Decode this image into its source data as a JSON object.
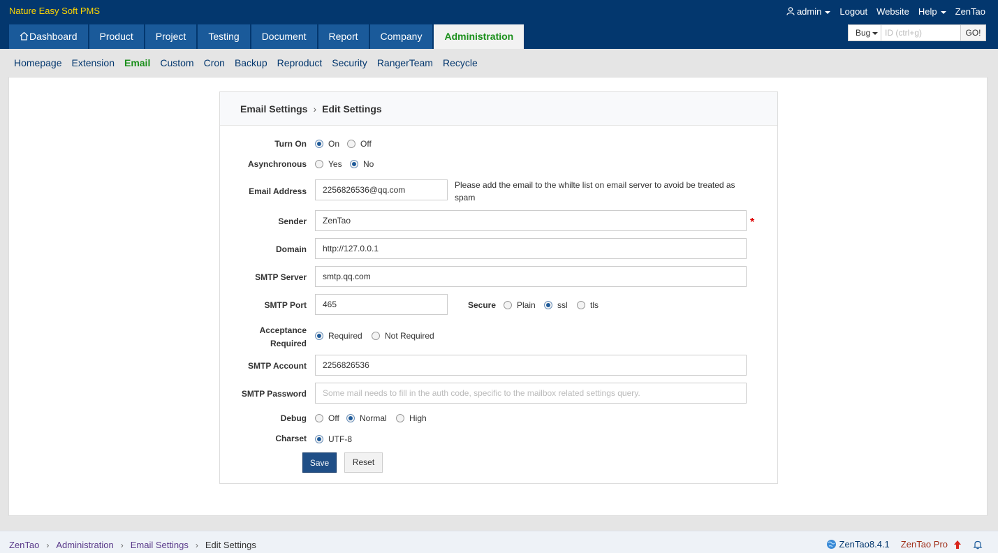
{
  "brand": "Nature Easy Soft PMS",
  "top_links": {
    "user": "admin",
    "logout": "Logout",
    "website": "Website",
    "help": "Help",
    "zentao": "ZenTao"
  },
  "main_nav": [
    "Dashboard",
    "Product",
    "Project",
    "Testing",
    "Document",
    "Report",
    "Company",
    "Administration"
  ],
  "search": {
    "type": "Bug",
    "placeholder": "ID (ctrl+g)",
    "go": "GO!"
  },
  "sub_nav": [
    "Homepage",
    "Extension",
    "Email",
    "Custom",
    "Cron",
    "Backup",
    "Reproduct",
    "Security",
    "RangerTeam",
    "Recycle"
  ],
  "form": {
    "title": "Email Settings",
    "subtitle": "Edit Settings",
    "turn_on": {
      "label": "Turn On",
      "options": [
        "On",
        "Off"
      ],
      "selected": "On"
    },
    "asynchronous": {
      "label": "Asynchronous",
      "options": [
        "Yes",
        "No"
      ],
      "selected": "No"
    },
    "email_address": {
      "label": "Email Address",
      "value": "2256826536@qq.com",
      "note": "Please add the email to the whilte list on email server to avoid be treated as spam"
    },
    "sender": {
      "label": "Sender",
      "value": "ZenTao",
      "required": "*"
    },
    "domain": {
      "label": "Domain",
      "value": "http://127.0.0.1"
    },
    "smtp_server": {
      "label": "SMTP Server",
      "value": "smtp.qq.com"
    },
    "smtp_port": {
      "label": "SMTP Port",
      "value": "465"
    },
    "secure": {
      "label": "Secure",
      "options": [
        "Plain",
        "ssl",
        "tls"
      ],
      "selected": "ssl"
    },
    "acceptance": {
      "label_line1": "Acceptance",
      "label_line2": "Required",
      "options": [
        "Required",
        "Not Required"
      ],
      "selected": "Required"
    },
    "smtp_account": {
      "label": "SMTP Account",
      "value": "2256826536"
    },
    "smtp_password": {
      "label": "SMTP Password",
      "placeholder": "Some mail needs to fill in the auth code, specific to the mailbox related settings query."
    },
    "debug": {
      "label": "Debug",
      "options": [
        "Off",
        "Normal",
        "High"
      ],
      "selected": "Normal"
    },
    "charset": {
      "label": "Charset",
      "options": [
        "UTF-8"
      ],
      "selected": "UTF-8"
    },
    "save": "Save",
    "reset": "Reset"
  },
  "footer": {
    "breadcrumb": [
      "ZenTao",
      "Administration",
      "Email Settings",
      "Edit Settings"
    ],
    "version": "ZenTao8.4.1",
    "pro": "ZenTao Pro"
  },
  "colors": {
    "header_bg": "#03376e",
    "tab_bg": "#1a5a9a",
    "active_green": "#1a8f1a",
    "brand_yellow": "#ffd700",
    "save_blue": "#1f4e86"
  }
}
